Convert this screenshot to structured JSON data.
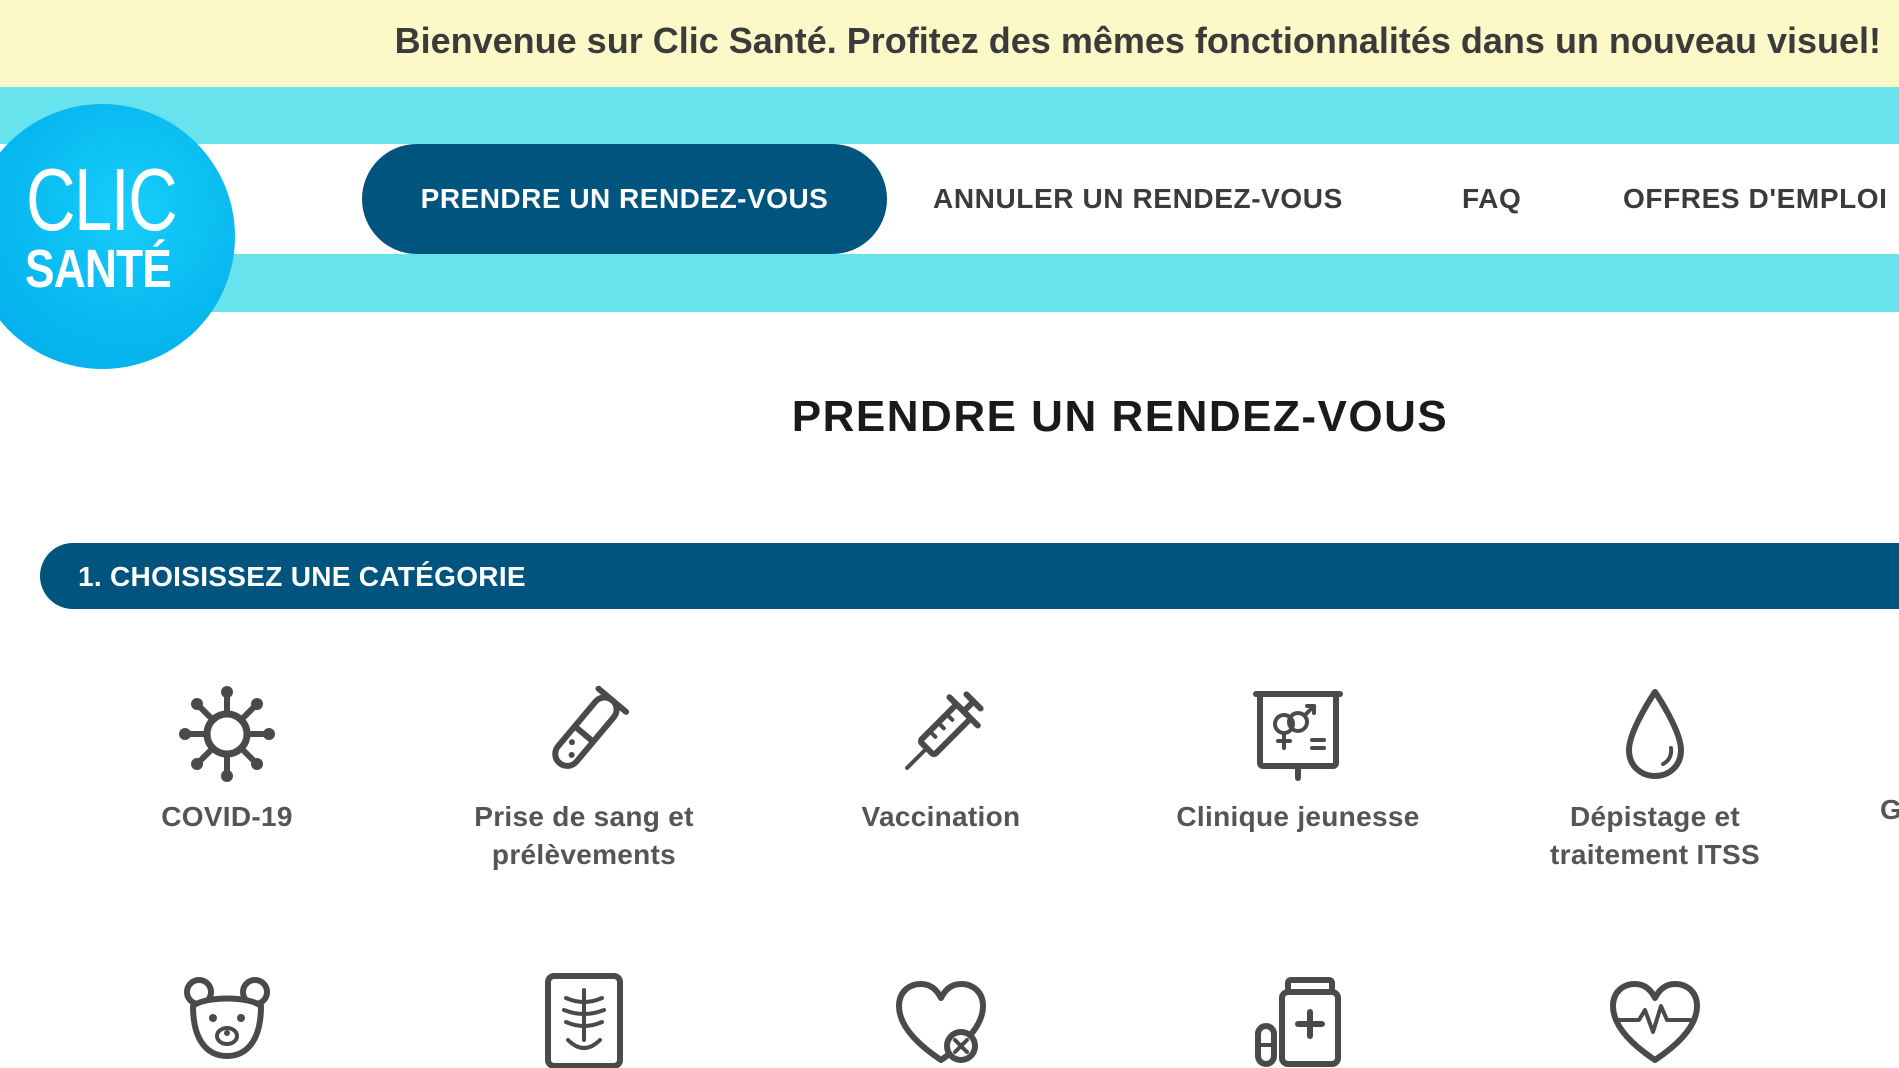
{
  "banner": {
    "text": "Bienvenue sur Clic Santé. Profitez des mêmes fonctionnalités dans un nouveau visuel!"
  },
  "logo": {
    "line1": "CLIC",
    "line2": "SANTÉ"
  },
  "nav": {
    "items": [
      {
        "label": "PRENDRE UN RENDEZ-VOUS",
        "active": true
      },
      {
        "label": "ANNULER UN RENDEZ-VOUS",
        "active": false
      },
      {
        "label": "FAQ",
        "active": false
      },
      {
        "label": "OFFRES D'EMPLOI",
        "active": false
      }
    ]
  },
  "main": {
    "title": "PRENDRE UN RENDEZ-VOUS",
    "step1": "1. CHOISISSEZ UNE CATÉGORIE",
    "categories": [
      {
        "label_line1": "COVID-19",
        "label_line2": "",
        "icon": "virus-icon"
      },
      {
        "label_line1": "Prise de sang et",
        "label_line2": "prélèvements",
        "icon": "test-tube-icon"
      },
      {
        "label_line1": "Vaccination",
        "label_line2": "",
        "icon": "syringe-icon"
      },
      {
        "label_line1": "Clinique jeunesse",
        "label_line2": "",
        "icon": "gender-board-icon"
      },
      {
        "label_line1": "Dépistage et",
        "label_line2": "traitement ITSS",
        "icon": "drop-icon"
      }
    ],
    "partial_next_label": "G",
    "row2_icons": [
      "bear-icon",
      "xray-icon",
      "heart-x-icon",
      "medication-icon",
      "heartbeat-icon"
    ]
  },
  "colors": {
    "banner_bg": "#fbf9c7",
    "nav_band": "#67e3ee",
    "primary_dark": "#01547e",
    "logo_blue": "#07b8ef"
  }
}
